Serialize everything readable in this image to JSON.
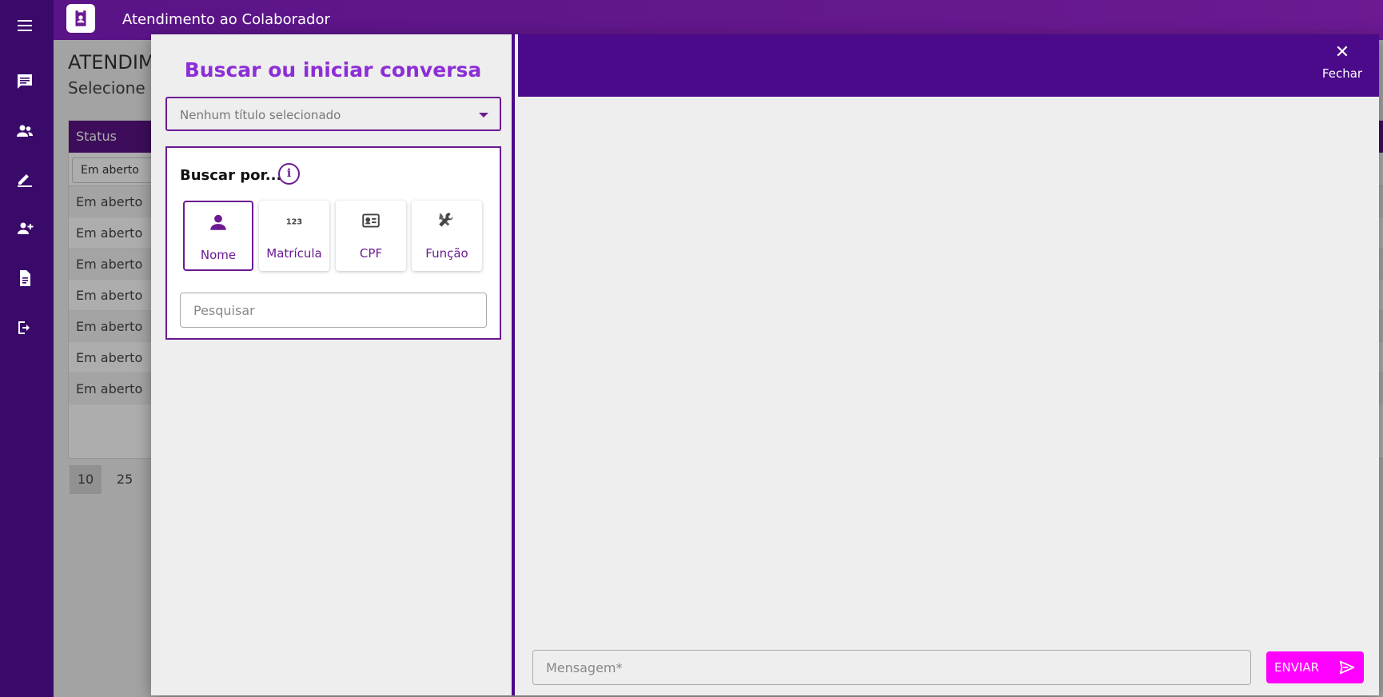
{
  "header": {
    "title": "Atendimento ao Colaborador"
  },
  "rail": {
    "icons": [
      "menu-icon",
      "chat-icon",
      "users-icon",
      "edit-icon",
      "add-user-icon",
      "document-icon",
      "logout-icon"
    ]
  },
  "background": {
    "title": "ATENDIM",
    "subtitle": "Selecione a",
    "table": {
      "column_status": "Status",
      "filter_value": "Em aberto",
      "rows": [
        "Em aberto",
        "Em aberto",
        "Em aberto",
        "Em aberto",
        "Em aberto",
        "Em aberto",
        "Em aberto"
      ]
    },
    "pager": [
      "10",
      "25"
    ]
  },
  "dialog": {
    "title": "Buscar ou iniciar conversa",
    "select": {
      "value": "Nenhum título selecionado"
    },
    "search": {
      "label": "Buscar por...",
      "options": [
        {
          "label": "Nome",
          "icon": "person-icon",
          "selected": true
        },
        {
          "label": "Matrícula",
          "icon": "numbers-icon",
          "selected": false
        },
        {
          "label": "CPF",
          "icon": "id-card-icon",
          "selected": false
        },
        {
          "label": "Função",
          "icon": "tools-icon",
          "selected": false
        }
      ],
      "placeholder": "Pesquisar"
    },
    "close_label": "Fechar",
    "message": {
      "placeholder": "Mensagem*"
    },
    "send_label": "ENVIAR"
  },
  "colors": {
    "primary": "#6b1a92",
    "dark_purple": "#4b0a8a",
    "title_purple": "#8c2ed6",
    "send_button": "#ff00ff",
    "rail": "#3a0a6b"
  }
}
